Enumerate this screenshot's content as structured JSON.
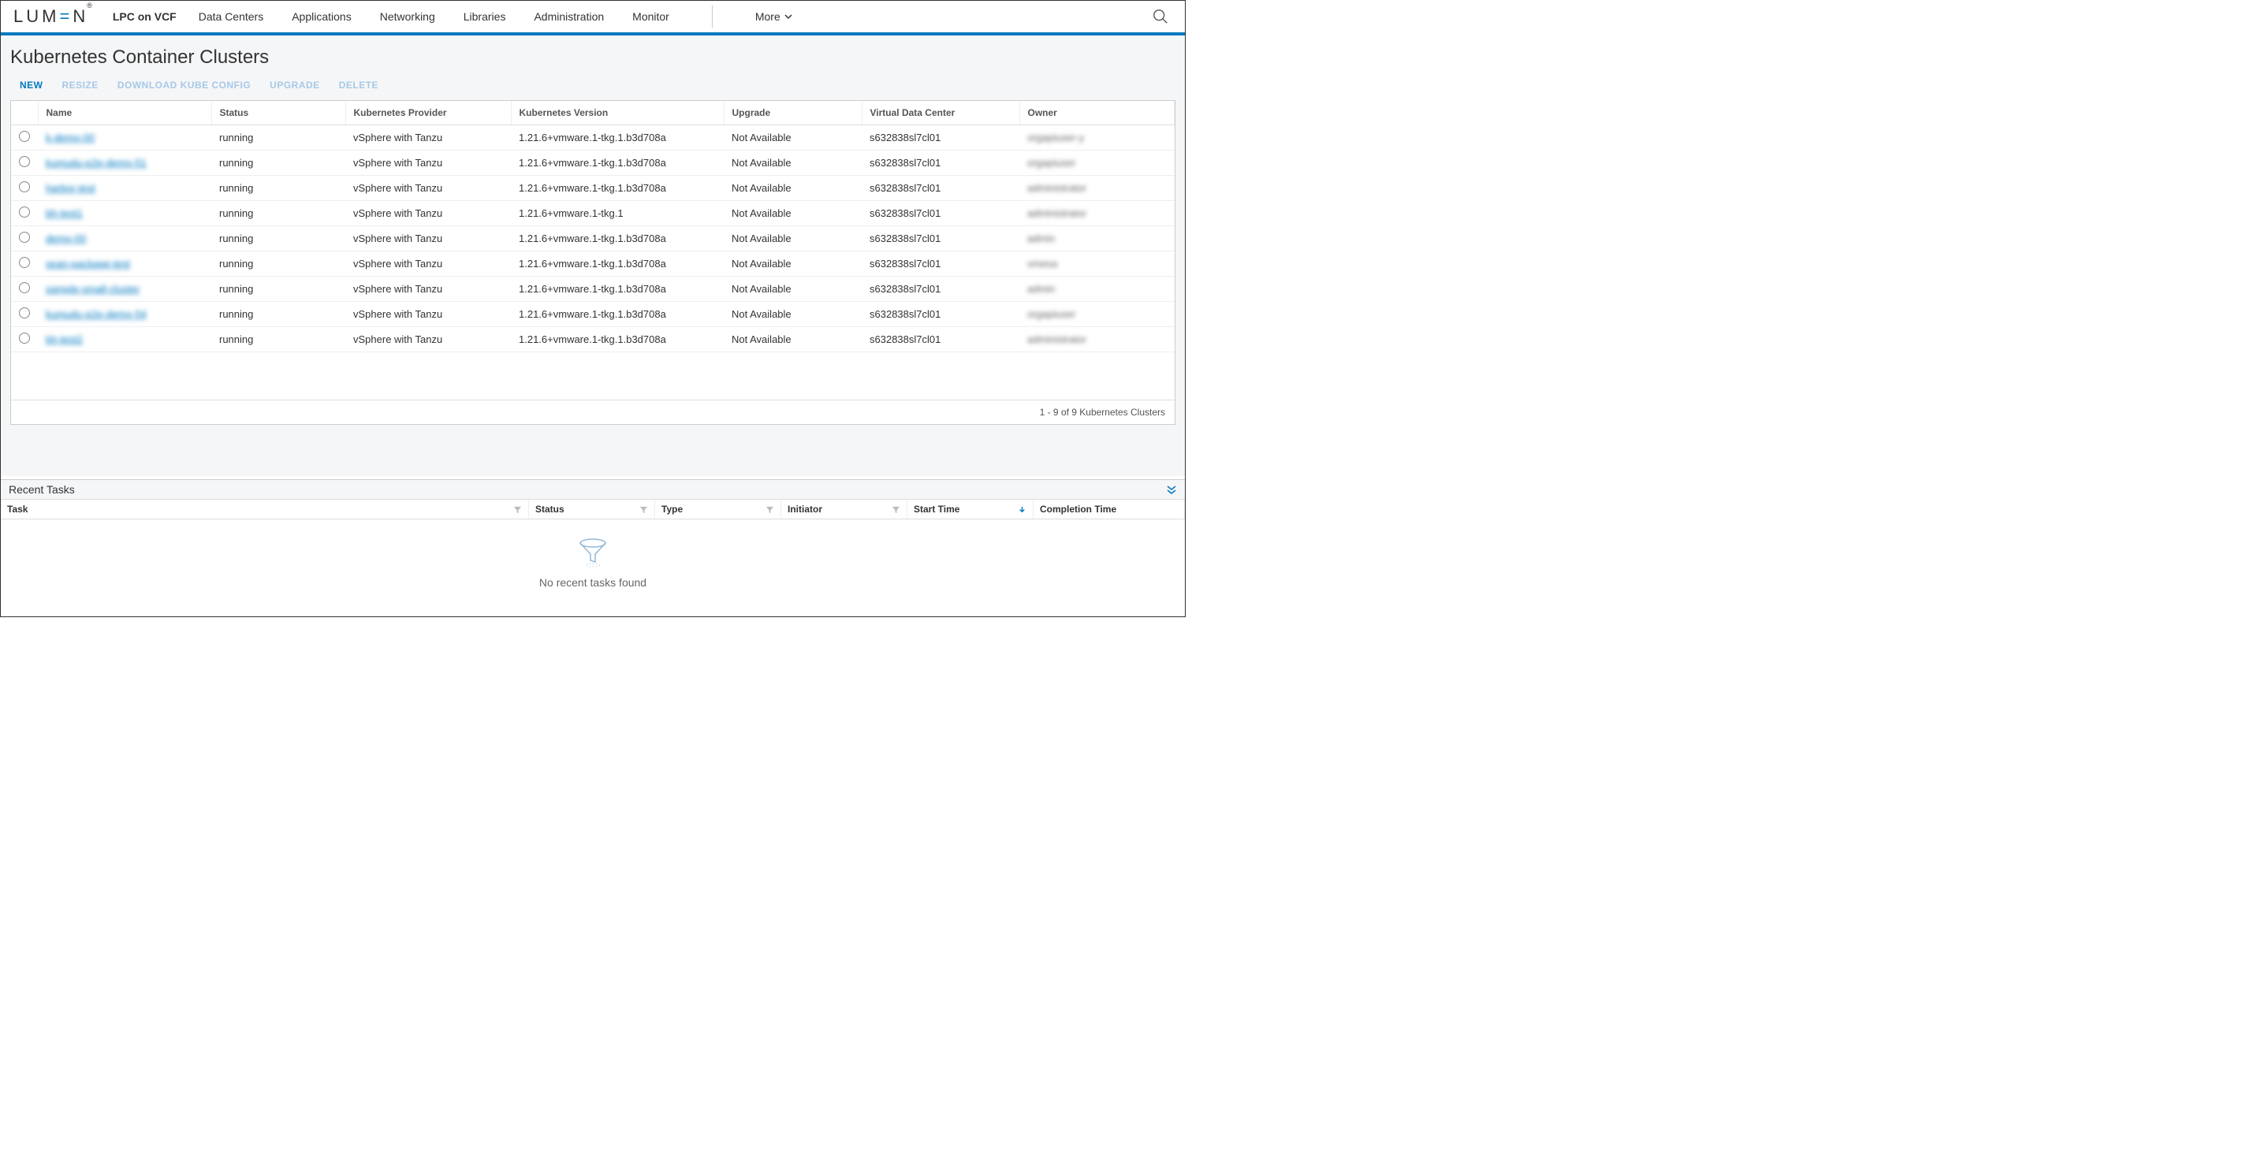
{
  "header": {
    "logo_text": "LUMEN",
    "brand": "LPC on VCF",
    "nav": [
      "Data Centers",
      "Applications",
      "Networking",
      "Libraries",
      "Administration",
      "Monitor"
    ],
    "more": "More"
  },
  "page": {
    "title": "Kubernetes Container Clusters",
    "actions": [
      "NEW",
      "RESIZE",
      "DOWNLOAD KUBE CONFIG",
      "UPGRADE",
      "DELETE"
    ]
  },
  "table": {
    "headers": [
      "Name",
      "Status",
      "Kubernetes Provider",
      "Kubernetes Version",
      "Upgrade",
      "Virtual Data Center",
      "Owner"
    ],
    "rows": [
      {
        "name": "k-demo-00",
        "status": "running",
        "provider": "vSphere with Tanzu",
        "version": "1.21.6+vmware.1-tkg.1.b3d708a",
        "upgrade": "Not Available",
        "vdc": "s632838sl7cl01",
        "owner": "orgapiuser-y"
      },
      {
        "name": "kumudu-e2e-demo-51",
        "status": "running",
        "provider": "vSphere with Tanzu",
        "version": "1.21.6+vmware.1-tkg.1.b3d708a",
        "upgrade": "Not Available",
        "vdc": "s632838sl7cl01",
        "owner": "orgapiuser"
      },
      {
        "name": "harbor-test",
        "status": "running",
        "provider": "vSphere with Tanzu",
        "version": "1.21.6+vmware.1-tkg.1.b3d708a",
        "upgrade": "Not Available",
        "vdc": "s632838sl7cl01",
        "owner": "administrator"
      },
      {
        "name": "bh-test1",
        "status": "running",
        "provider": "vSphere with Tanzu",
        "version": "1.21.6+vmware.1-tkg.1",
        "upgrade": "Not Available",
        "vdc": "s632838sl7cl01",
        "owner": "administrator"
      },
      {
        "name": "demo-00",
        "status": "running",
        "provider": "vSphere with Tanzu",
        "version": "1.21.6+vmware.1-tkg.1.b3d708a",
        "upgrade": "Not Available",
        "vdc": "s632838sl7cl01",
        "owner": "admin"
      },
      {
        "name": "sean-package-test",
        "status": "running",
        "provider": "vSphere with Tanzu",
        "version": "1.21.6+vmware.1-tkg.1.b3d708a",
        "upgrade": "Not Available",
        "vdc": "s632838sl7cl01",
        "owner": "vmesa"
      },
      {
        "name": "sample-small-cluster",
        "status": "running",
        "provider": "vSphere with Tanzu",
        "version": "1.21.6+vmware.1-tkg.1.b3d708a",
        "upgrade": "Not Available",
        "vdc": "s632838sl7cl01",
        "owner": "admin"
      },
      {
        "name": "kumudu-e2e-demo-54",
        "status": "running",
        "provider": "vSphere with Tanzu",
        "version": "1.21.6+vmware.1-tkg.1.b3d708a",
        "upgrade": "Not Available",
        "vdc": "s632838sl7cl01",
        "owner": "orgapiuser"
      },
      {
        "name": "bh-test2",
        "status": "running",
        "provider": "vSphere with Tanzu",
        "version": "1.21.6+vmware.1-tkg.1.b3d708a",
        "upgrade": "Not Available",
        "vdc": "s632838sl7cl01",
        "owner": "administrator"
      }
    ],
    "footer": "1 - 9 of 9 Kubernetes Clusters"
  },
  "tasks": {
    "title": "Recent Tasks",
    "columns": [
      "Task",
      "Status",
      "Type",
      "Initiator",
      "Start Time",
      "Completion Time"
    ],
    "empty": "No recent tasks found"
  }
}
